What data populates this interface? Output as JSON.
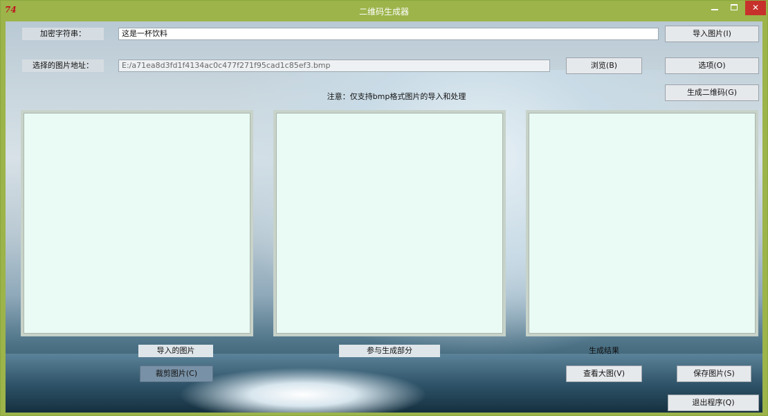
{
  "window": {
    "app_icon": "74",
    "title": "二维码生成器",
    "title_color": "#9cb44a",
    "close_color": "#c7312b"
  },
  "form": {
    "string_label": "加密字符串：",
    "string_value": "这是一杯饮料",
    "path_label": "选择的图片地址：",
    "path_value": "E:/a71ea8d3fd1f4134ac0c477f271f95cad1c85ef3.bmp",
    "browse_button": "浏览(B)",
    "note": "注意：仅支持bmp格式图片的导入和处理"
  },
  "side_buttons": {
    "import_image": "导入图片(I)",
    "options": "选项(O)",
    "generate_qr": "生成二维码(G)",
    "save_image": "保存图片(S)",
    "exit": "退出程序(Q)"
  },
  "panels": {
    "imported_caption": "导入的图片",
    "participate_caption": "参与生成部分",
    "result_caption": "生成结果",
    "panel_color": "#e9fbf4"
  },
  "bottom_buttons": {
    "crop_image": "裁剪图片(C)",
    "view_large": "查看大图(V)"
  }
}
